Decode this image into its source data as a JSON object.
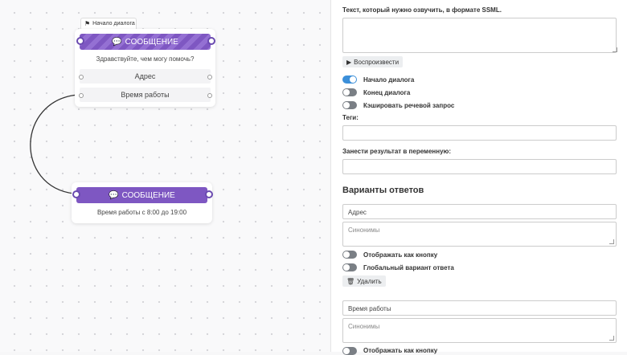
{
  "canvas": {
    "start_tag": "Начало диалога",
    "node1": {
      "header": "СООБЩЕНИЕ",
      "text": "Здравствуйте, чем могу помочь?",
      "answers": [
        "Адрес",
        "Время работы"
      ]
    },
    "node2": {
      "header": "СООБЩЕНИЕ",
      "text": "Время работы с 8:00 до 19:00"
    }
  },
  "panel": {
    "ssml_label": "Текст, который нужно озвучить, в формате SSML.",
    "ssml_value": "",
    "play_button": "Воспроизвести",
    "toggles": [
      {
        "label": "Начало диалога",
        "on": true
      },
      {
        "label": "Конец диалога",
        "on": false
      },
      {
        "label": "Кэшировать речевой запрос",
        "on": false
      }
    ],
    "tags_label": "Теги:",
    "tags_value": "",
    "variable_label": "Занести результат в переменную:",
    "variable_value": "",
    "answers_title": "Варианты ответов",
    "answers": [
      {
        "value": "Адрес",
        "synonyms_placeholder": "Синонимы",
        "show_as_button": "Отображать как кнопку",
        "global_answer": "Глобальный вариант ответа",
        "delete_button": "Удалить"
      },
      {
        "value": "Время работы",
        "synonyms_placeholder": "Синонимы",
        "show_as_button": "Отображать как кнопку"
      }
    ]
  },
  "colors": {
    "node_header": "#7e57c2",
    "toggle_on": "#3b8fd9",
    "toggle_off": "#7a7f85"
  }
}
